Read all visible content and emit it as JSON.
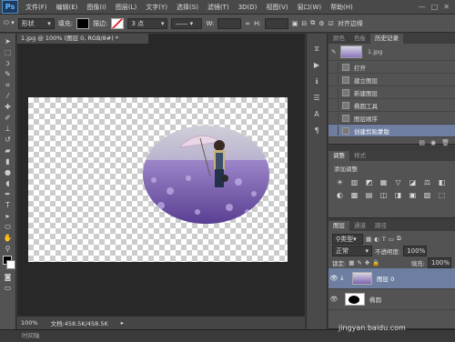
{
  "menu": {
    "logo": "Ps",
    "items": [
      "文件(F)",
      "编辑(E)",
      "图像(I)",
      "图层(L)",
      "文字(Y)",
      "选择(S)",
      "滤镜(T)",
      "3D(D)",
      "视图(V)",
      "窗口(W)",
      "帮助(H)"
    ],
    "window_buttons": [
      "—",
      "□",
      "✕"
    ]
  },
  "options": {
    "shape_mode": "形状",
    "fill_label": "填充:",
    "stroke_label": "描边:",
    "stroke_size": "3 点",
    "w_label": "W:",
    "h_label": "H:",
    "align_edges": "对齐边缘"
  },
  "document": {
    "tab_title": "1.jpg @ 100% (图层 0, RGB/8#) *",
    "zoom": "100%",
    "doc_info": "文档:458.5K/458.5K"
  },
  "bottom_tab": "时间轴",
  "history": {
    "tabs": [
      "颜色",
      "色板",
      "历史记录"
    ],
    "snapshot": "1.jpg",
    "items": [
      "打开",
      "建立图层",
      "新建图层",
      "椭圆工具",
      "图层顺序",
      "创建剪贴蒙版"
    ],
    "selected_index": 5
  },
  "adjustments": {
    "tabs": [
      "调整",
      "样式"
    ],
    "title": "添加调整",
    "icons": [
      "☀",
      "▥",
      "◩",
      "▦",
      "▽",
      "◪",
      "⚖",
      "◧",
      "◐",
      "▩",
      "▤",
      "◫",
      "◨",
      "▣",
      "▧",
      "⬚"
    ]
  },
  "layers": {
    "tabs": [
      "图层",
      "通道",
      "路径"
    ],
    "kind": "类型",
    "blend_mode": "正常",
    "opacity_label": "不透明度:",
    "opacity": "100%",
    "lock_label": "锁定:",
    "fill_label": "填充:",
    "fill": "100%",
    "items": [
      "图层 0",
      "椭圆"
    ]
  },
  "colors": {
    "foreground": "#000000",
    "selection": "#6d7ea0"
  },
  "watermark": "jingyan.baidu.com"
}
